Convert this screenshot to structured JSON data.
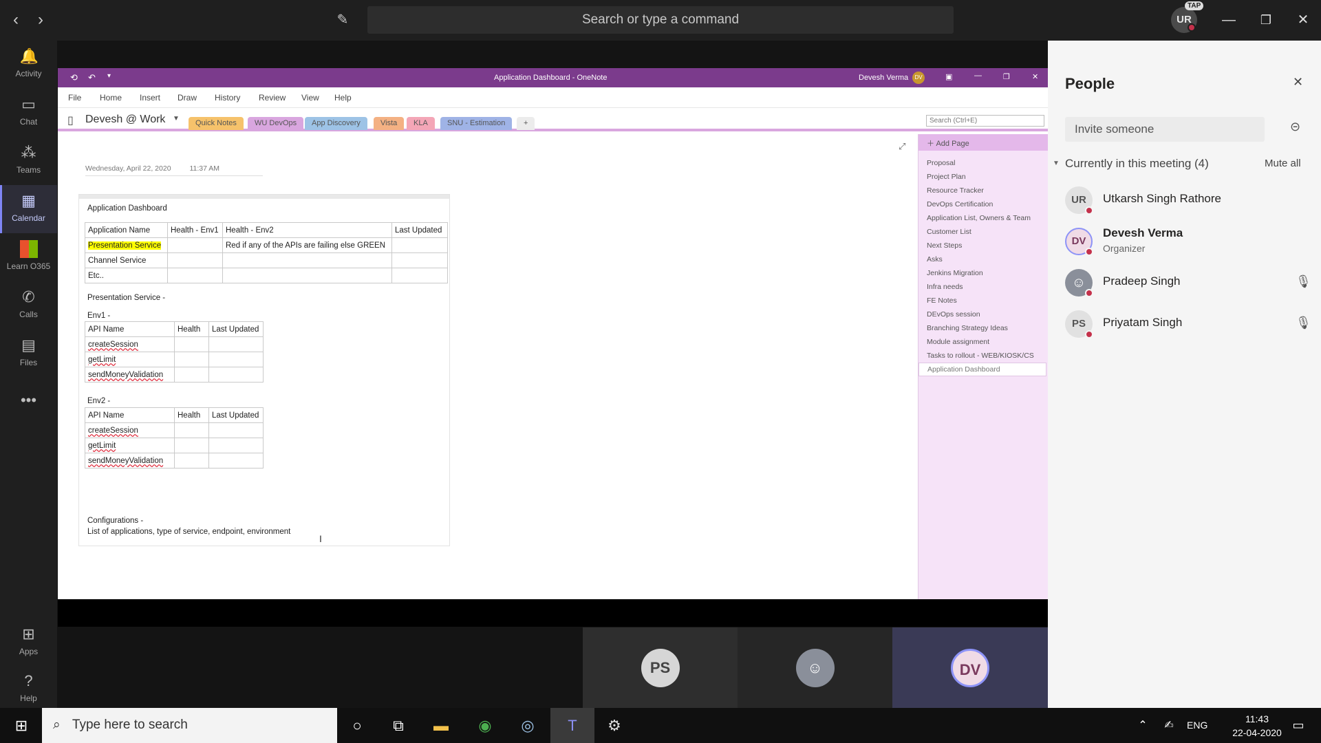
{
  "teams": {
    "search_placeholder": "Search or type a command",
    "user_initials": "UR",
    "tap_badge": "TAP",
    "rail": [
      {
        "label": "Activity",
        "icon": "bell-icon"
      },
      {
        "label": "Chat",
        "icon": "chat-icon"
      },
      {
        "label": "Teams",
        "icon": "teams-icon"
      },
      {
        "label": "Calendar",
        "icon": "calendar-icon"
      },
      {
        "label": "Learn O365",
        "icon": "learn-icon"
      },
      {
        "label": "Calls",
        "icon": "phone-icon"
      },
      {
        "label": "Files",
        "icon": "files-icon"
      },
      {
        "label": "Apps",
        "icon": "apps-icon"
      },
      {
        "label": "Help",
        "icon": "help-icon"
      }
    ],
    "active_rail": "Calendar"
  },
  "onenote": {
    "window_title": "Application Dashboard  -  OneNote",
    "user_name": "Devesh Verma",
    "user_initials": "DV",
    "menu": [
      "File",
      "Home",
      "Insert",
      "Draw",
      "History",
      "Review",
      "View",
      "Help"
    ],
    "notebook": "Devesh @ Work",
    "tabs": [
      {
        "label": "Quick Notes",
        "color": "#f6c26b"
      },
      {
        "label": "WU DevOps",
        "color": "#d9a6df"
      },
      {
        "label": "App Discovery",
        "color": "#9dc3e6"
      },
      {
        "label": "Vista",
        "color": "#f4b183"
      },
      {
        "label": "KLA",
        "color": "#f4a6b7"
      },
      {
        "label": "SNU - Estimation",
        "color": "#9fb3e6"
      },
      {
        "label": "+",
        "color": "#ececec"
      }
    ],
    "search_placeholder": "Search (Ctrl+E)",
    "add_page": "Add Page",
    "pages": [
      "Proposal",
      "Project Plan",
      "Resource Tracker",
      "DevOps Certification",
      "Application List, Owners & Team",
      "Customer List",
      "Next Steps",
      "Asks",
      "Jenkins Migration",
      "Infra needs",
      "FE Notes",
      "DEvOps session",
      "Branching Strategy Ideas",
      "Module assignment",
      "Tasks to rollout - WEB/KIOSK/CS",
      "Application Dashboard"
    ],
    "page": {
      "date": "Wednesday, April 22, 2020",
      "time": "11:37 AM",
      "title": "Application Dashboard",
      "main_table": {
        "headers": [
          "Application Name",
          "Health - Env1",
          "Health - Env2",
          "Last Updated"
        ],
        "rows": [
          [
            "Presentation Service",
            "",
            "Red if any of the APIs are failing else GREEN",
            ""
          ],
          [
            "Channel Service",
            "",
            "",
            ""
          ],
          [
            "Etc..",
            "",
            "",
            ""
          ]
        ]
      },
      "presentation_heading": "Presentation Service -",
      "env1_label": "Env1 -",
      "env2_label": "Env2 -",
      "api_headers": [
        "API Name",
        "Health",
        "Last Updated"
      ],
      "env1_apis": [
        "createSession",
        "getLimit",
        "sendMoneyValidation"
      ],
      "env2_apis": [
        "createSession",
        "getLimit",
        "sendMoneyValidation"
      ],
      "config_heading": "Configurations -",
      "config_text": "List of applications, type of service, endpoint, environment"
    }
  },
  "people": {
    "title": "People",
    "invite_placeholder": "Invite someone",
    "section": "Currently in this meeting (4)",
    "mute_all": "Mute all",
    "participants": [
      {
        "initials": "UR",
        "name": "Utkarsh Singh Rathore",
        "role": "",
        "muted": false
      },
      {
        "initials": "DV",
        "name": "Devesh Verma",
        "role": "Organizer",
        "muted": false
      },
      {
        "initials": "",
        "name": "Pradeep Singh",
        "role": "",
        "muted": true
      },
      {
        "initials": "PS",
        "name": "Priyatam Singh",
        "role": "",
        "muted": true
      }
    ]
  },
  "tiles": [
    {
      "initials": "PS"
    },
    {
      "initials": ""
    },
    {
      "initials": "DV"
    }
  ],
  "taskbar": {
    "search_placeholder": "Type here to search",
    "language": "ENG",
    "time": "11:43",
    "date": "22-04-2020"
  }
}
